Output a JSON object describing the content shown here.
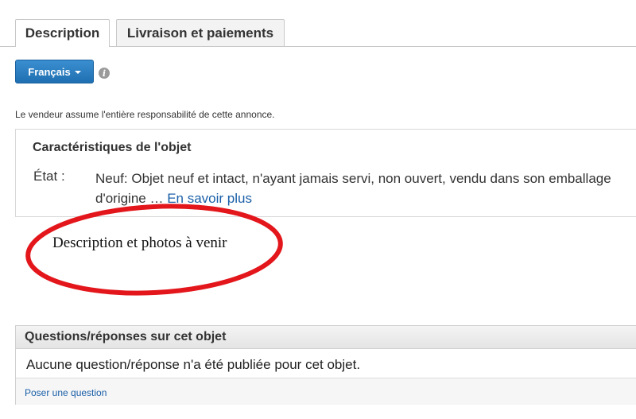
{
  "tabs": [
    {
      "label": "Description",
      "active": true
    },
    {
      "label": "Livraison et paiements",
      "active": false
    }
  ],
  "language": {
    "selected": "Français"
  },
  "info_icon": "info-icon",
  "disclaimer": "Le vendeur assume l'entière responsabilité de cette annonce.",
  "specifics": {
    "title": "Caractéristiques de l'objet",
    "condition_label": "État :",
    "condition_value": "Neuf: Objet neuf et intact, n'ayant jamais servi, non ouvert, vendu dans son emballage d'origine …",
    "more_link": "En savoir plus"
  },
  "description": {
    "text": "Description et photos à venir",
    "highlight_color": "#e3161b"
  },
  "qa": {
    "header": "Questions/réponses sur cet objet",
    "none_text": "Aucune question/réponse n'a été publiée pour cet objet.",
    "ask_link": "Poser une question"
  },
  "colors": {
    "accent": "#1f6fb1",
    "link": "#1a5fa8"
  }
}
